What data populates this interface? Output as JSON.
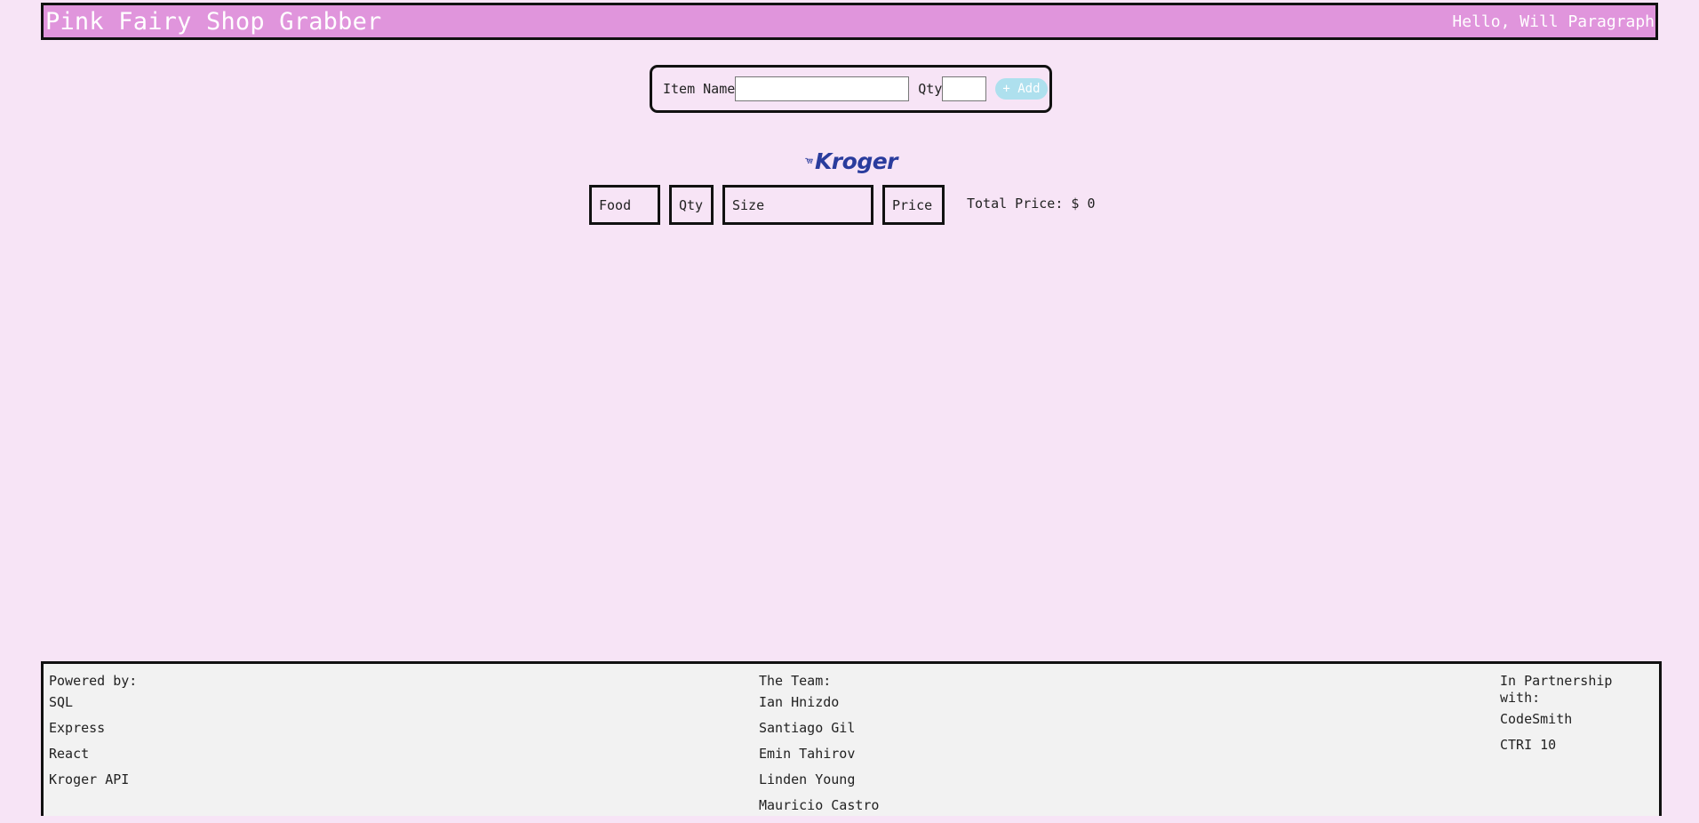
{
  "header": {
    "title": "Pink Fairy Shop Grabber",
    "greeting": "Hello, Will Paragraph"
  },
  "form": {
    "item_name_label": "Item Name",
    "item_name_value": "",
    "qty_label": "Qty",
    "qty_value": "",
    "add_button_label": "+ Add"
  },
  "logo": {
    "text": "Kroger",
    "icon": "shopping-cart-smile-icon"
  },
  "table": {
    "columns": [
      "Food",
      "Qty",
      "Size",
      "Price"
    ],
    "total_label": "Total Price:",
    "currency": "$",
    "total_value": "0"
  },
  "footer": {
    "powered_by": {
      "heading": "Powered by:",
      "items": [
        "SQL",
        "Express",
        "React",
        "Kroger API"
      ]
    },
    "team": {
      "heading": "The Team:",
      "items": [
        "Ian Hnizdo",
        "Santiago Gil",
        "Emin Tahirov",
        "Linden Young",
        "Mauricio Castro"
      ]
    },
    "partnership": {
      "heading": "In Partnership with:",
      "items": [
        "CodeSmith",
        "CTRI 10"
      ]
    }
  },
  "colors": {
    "background": "#f7e4f6",
    "header": "#e095dc",
    "button": "#aee0ee",
    "logo": "#2a3c9d",
    "footer": "#f2f2f2"
  }
}
